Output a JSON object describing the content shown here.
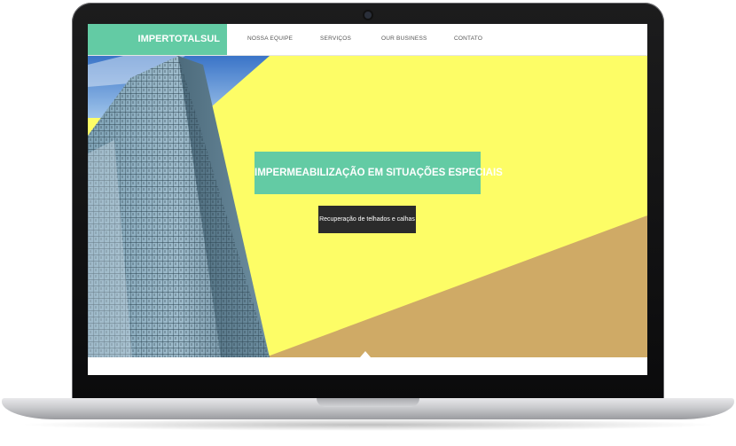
{
  "nav": {
    "brand": "IMPERTOTALSUL",
    "items": [
      "NOSSA EQUIPE",
      "SERVIÇOS",
      "OUR BUSINESS",
      "CONTATO"
    ]
  },
  "hero": {
    "headline": "IMPERMEABILIZAÇÃO EM SITUAÇÕES ESPECIAIS",
    "cta_label": "Recuperação de telhados e calhas"
  },
  "colors": {
    "brand": "#63cba4",
    "hero_yellow": "#fdfd66",
    "hero_tan": "#cfaa66",
    "cta_dark": "#2b2b2b"
  },
  "icons": {
    "down_caret": "scroll-caret-icon"
  }
}
